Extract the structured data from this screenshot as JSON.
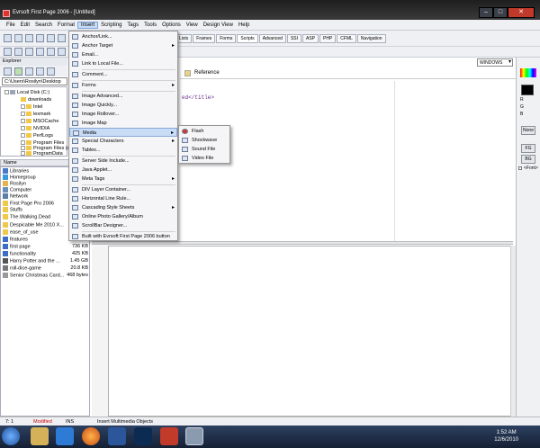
{
  "window": {
    "title": "Evrsoft First Page 2006 - [Untitled]",
    "min": "–",
    "max": "□",
    "close": "✕"
  },
  "menubar": [
    "File",
    "Edit",
    "Search",
    "Format",
    "Insert",
    "Scripting",
    "Tags",
    "Tools",
    "Options",
    "View",
    "Design View",
    "Help"
  ],
  "tabs": [
    "Lists",
    "Frames",
    "Forms",
    "Scripts",
    "Advanced",
    "SSI",
    "ASP",
    "PHP",
    "CFML",
    "Navigation"
  ],
  "doctype_combo": "WINDOWS",
  "explorer": {
    "label": "Explorer",
    "path": "C:\\Users\\Rosilyn\\Desktop",
    "tree": [
      "Local Disk (C:)",
      "downloads",
      "Intel",
      "lexmark",
      "MSOCache",
      "NVIDIA",
      "PerfLogs",
      "Program Files",
      "Program Files (x",
      "ProgramData"
    ]
  },
  "files": {
    "header": "Name",
    "rows": [
      {
        "name": "Libraries",
        "size": ""
      },
      {
        "name": "Homegroup",
        "size": ""
      },
      {
        "name": "Rosilyn",
        "size": ""
      },
      {
        "name": "Computer",
        "size": ""
      },
      {
        "name": "Network",
        "size": ""
      },
      {
        "name": "First Page Pro 2006",
        "size": ""
      },
      {
        "name": "Stuffs",
        "size": ""
      },
      {
        "name": "The.Walking.Dead",
        "size": ""
      },
      {
        "name": "Despicable Me 2010 X...",
        "size": ""
      },
      {
        "name": "ease_of_use",
        "size": ""
      },
      {
        "name": "features",
        "size": "430 KB"
      },
      {
        "name": "first page",
        "size": "736 KB"
      },
      {
        "name": "functionality",
        "size": "425 KB"
      },
      {
        "name": "Harry Potter and the ...",
        "size": "1.45 GB"
      },
      {
        "name": "roll-dice-game",
        "size": "20.8 KB"
      },
      {
        "name": "Senior Christmas Card...",
        "size": "468 bytes"
      }
    ]
  },
  "editor": {
    "reference_tab": "Reference",
    "code": "ed</title>"
  },
  "insert_menu": [
    {
      "label": "Anchor/Link...",
      "arrow": false
    },
    {
      "label": "Anchor Target",
      "arrow": true
    },
    {
      "label": "Email...",
      "arrow": false
    },
    {
      "label": "Link to Local File...",
      "arrow": false
    },
    {
      "label": "Comment...",
      "arrow": false
    },
    {
      "label": "Forms",
      "arrow": true
    },
    {
      "label": "Image Advanced...",
      "arrow": false
    },
    {
      "label": "Image Quickly...",
      "arrow": false
    },
    {
      "label": "Image Rollover...",
      "arrow": false
    },
    {
      "label": "Image Map",
      "arrow": false
    },
    {
      "label": "Media",
      "arrow": true
    },
    {
      "label": "Special Characters",
      "arrow": true
    },
    {
      "label": "Tables...",
      "arrow": false
    },
    {
      "label": "Server Side Include...",
      "arrow": false
    },
    {
      "label": "Java Applet...",
      "arrow": false
    },
    {
      "label": "Meta Tags",
      "arrow": true
    },
    {
      "label": "DIV Layer Container...",
      "arrow": false
    },
    {
      "label": "Horizontal Line Rule...",
      "arrow": false
    },
    {
      "label": "Cascading Style Sheets",
      "arrow": true
    },
    {
      "label": "Online Photo Gallery/Album",
      "arrow": false
    },
    {
      "label": "ScrollBar Designer...",
      "arrow": false
    },
    {
      "label": "Built with Evrsoft First Page 2006 button",
      "arrow": false
    }
  ],
  "media_menu": [
    "Flash",
    "Shockwave",
    "Sound File",
    "Video File"
  ],
  "right_panel": {
    "r": "R",
    "g": "G",
    "b": "B",
    "none": "None",
    "fg": "FG",
    "bg": "BG",
    "font": "<Font>"
  },
  "status": {
    "pos": "7: 1",
    "modified": "Modified",
    "ins": "INS",
    "hint": "Insert Multimedia Objects"
  },
  "clock": {
    "time": "1:52 AM",
    "date": "12/6/2010"
  },
  "colors": {
    "accent": "#c8dcf6",
    "modified": "#cc0000"
  }
}
